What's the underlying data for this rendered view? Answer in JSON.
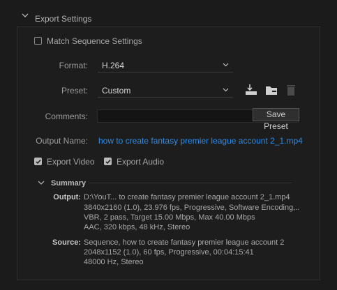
{
  "section": {
    "title": "Export Settings"
  },
  "match_sequence": {
    "label": "Match Sequence Settings",
    "checked": false
  },
  "format": {
    "label": "Format:",
    "value": "H.264"
  },
  "preset": {
    "label": "Preset:",
    "value": "Custom"
  },
  "comments": {
    "label": "Comments:",
    "value": ""
  },
  "save_preset": {
    "label": "Save Preset"
  },
  "output_name": {
    "label": "Output Name:",
    "value": "how to create fantasy premier league account 2_1.mp4"
  },
  "export_video": {
    "label": "Export Video",
    "checked": true
  },
  "export_audio": {
    "label": "Export Audio",
    "checked": true
  },
  "summary": {
    "title": "Summary",
    "output_key": "Output:",
    "output_lines": [
      "D:\\YouT... to create fantasy premier league account 2_1.mp4",
      "3840x2160 (1.0), 23.976 fps, Progressive, Software Encoding,..",
      "VBR, 2 pass, Target 15.00 Mbps, Max 40.00 Mbps",
      "AAC, 320 kbps, 48 kHz, Stereo"
    ],
    "source_key": "Source:",
    "source_lines": [
      "Sequence, how to create fantasy premier league account 2",
      "2048x1152 (1.0), 60 fps, Progressive, 00:04:15:41",
      "48000 Hz, Stereo"
    ]
  },
  "colors": {
    "accent_link": "#2d8ceb",
    "panel_bg": "#1d1d1d"
  },
  "icons": [
    "chevron-down-icon",
    "import-preset-icon",
    "manage-presets-icon",
    "delete-preset-icon"
  ]
}
